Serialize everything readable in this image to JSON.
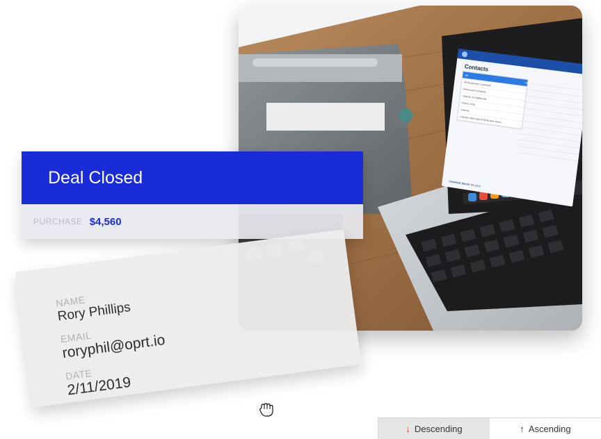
{
  "deal": {
    "title": "Deal Closed",
    "purchase_label": "PURCHASE",
    "purchase_value": "$4,560"
  },
  "contact": {
    "name_label": "NAME",
    "name_value": "Rory Phillips",
    "email_label": "EMAIL",
    "email_value": "roryphil@oprt.io",
    "date_label": "DATE",
    "date_value": "2/11/2019"
  },
  "photo_screen": {
    "title": "Contacts",
    "menu_items": [
      "All",
      "All Business Contacts",
      "Personal Contacts",
      "Clients in California",
      "Fierce Grip",
      "Clients",
      "Clients have spent $1M and more"
    ],
    "footer": "CHANGE BACK TO v1.0"
  },
  "sort": {
    "descending_arrow": "↓",
    "descending_label": "Descending",
    "ascending_arrow": "↑",
    "ascending_label": "Ascending",
    "active": "descending"
  },
  "colors": {
    "accent_blue": "#1a2bd8",
    "descending_arrow": "#e0361f"
  },
  "icons": {
    "cursor": "grab-hand-icon"
  }
}
